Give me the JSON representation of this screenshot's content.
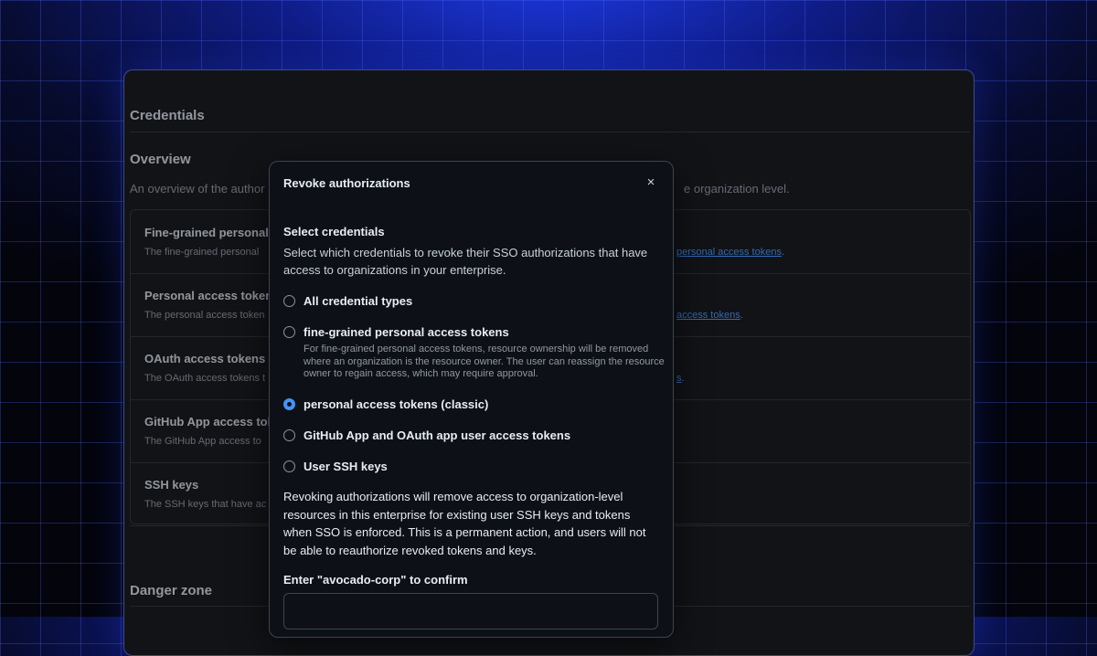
{
  "background": {
    "sections": {
      "credentials_title": "Credentials",
      "overview_title": "Overview",
      "overview_desc": "An overview of the author",
      "overview_desc_tail": "e organization level.",
      "danger_title": "Danger zone"
    },
    "rows": [
      {
        "name": "Fine-grained personal",
        "desc": "The fine-grained personal",
        "link": "personal access tokens",
        "link_suffix": "."
      },
      {
        "name": "Personal access token",
        "desc": "The personal access token",
        "link": "access tokens",
        "link_suffix": "."
      },
      {
        "name": "OAuth access tokens",
        "desc": "The OAuth access tokens t",
        "link": "s",
        "link_suffix": "."
      },
      {
        "name": "GitHub App access tok",
        "desc": "The GitHub App access to",
        "link": "",
        "link_suffix": ""
      },
      {
        "name": "SSH keys",
        "desc": "The SSH keys that have ac",
        "link": "",
        "link_suffix": ""
      }
    ]
  },
  "modal": {
    "title": "Revoke authorizations",
    "close_icon": "×",
    "select_title": "Select credentials",
    "select_desc": "Select which credentials to revoke their SSO authorizations that have access to organizations in your enterprise.",
    "options": [
      {
        "label": "All credential types",
        "checked": false
      },
      {
        "label": "fine-grained personal access tokens",
        "checked": false
      },
      {
        "label": "personal access tokens (classic)",
        "checked": true
      },
      {
        "label": "GitHub App and OAuth app user access tokens",
        "checked": false
      },
      {
        "label": "User SSH keys",
        "checked": false
      }
    ],
    "fine_grained_note": "For fine-grained personal access tokens, resource ownership will be removed where an organization is the resource owner. The user can reassign the resource owner to regain access, which may require approval.",
    "warning": "Revoking authorizations will remove access to organization-level resources in this enterprise for existing user SSH keys and tokens when SSO is enforced. This is a permanent action, and users will not be able to reauthorize revoked tokens and keys.",
    "confirm_label": "Enter \"avocado-corp\" to confirm",
    "confirm_value": "",
    "accent_color": "#4493f8"
  }
}
